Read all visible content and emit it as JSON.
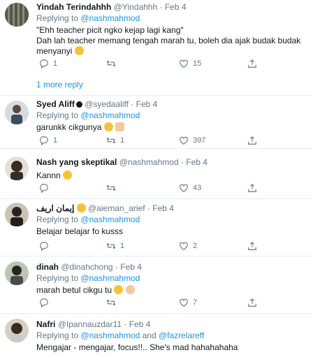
{
  "tweets": [
    {
      "name": "Yindah Terindahhh",
      "handle": "@Yindahhh",
      "sep": "·",
      "date": "Feb 4",
      "replying_label": "Replying to",
      "replying_to": "@nashmahmod",
      "text_line1": "\"Ehh teacher picit ngko kejap lagi kang\"",
      "text_line2": "Dah lah teacher memang tengah marah tu, boleh dia ajak budak budak",
      "text_line3": "menyanyi",
      "replies": "1",
      "retweets": "",
      "likes": "15"
    },
    {
      "name": "Syed Aliff",
      "handle": "@syedaaliff",
      "sep": "·",
      "date": "Feb 4",
      "replying_label": "Replying to",
      "replying_to": "@nashmahmod",
      "text_line1": "garunkk cikgunya",
      "replies": "1",
      "retweets": "1",
      "likes": "397"
    },
    {
      "name": "Nash yang skeptikal",
      "handle": "@nashmahmod",
      "sep": "·",
      "date": "Feb 4",
      "text_line1": "Kannn",
      "replies": "",
      "retweets": "",
      "likes": "43"
    },
    {
      "name": "إيمان اريف",
      "handle": "@aieman_arief",
      "sep": "·",
      "date": "Feb 4",
      "replying_label": "Replying to",
      "replying_to": "@nashmahmod",
      "text_line1": "Belajar belajar fo kusss",
      "replies": "",
      "retweets": "1",
      "likes": "2"
    },
    {
      "name": "dinah",
      "handle": "@dinahchong",
      "sep": "·",
      "date": "Feb 4",
      "replying_label": "Replying to",
      "replying_to": "@nashmahmod",
      "text_line1": "marah betul cikgu tu",
      "replies": "",
      "retweets": "",
      "likes": "7"
    },
    {
      "name": "Nafri",
      "handle": "@Ipannauzdar11",
      "sep": "·",
      "date": "Feb 4",
      "replying_label": "Replying to",
      "replying_to": "@nashmahmod",
      "and_label": "and",
      "replying_to2": "@fazrelareff",
      "text_line1": "Mengajar - mengajar, focus!!.. She's mad hahahahaha"
    }
  ],
  "more_replies": "1 more reply",
  "colors": {
    "accent": "#1b95e0",
    "muted": "#657786",
    "text": "#14171a",
    "divider": "#e6ecf0"
  }
}
